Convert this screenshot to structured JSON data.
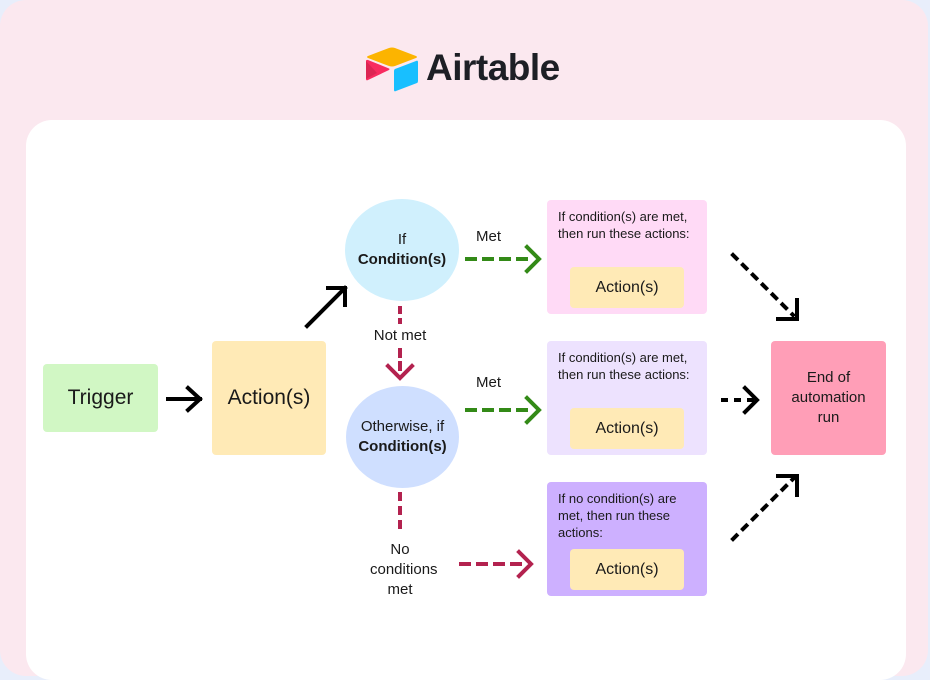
{
  "brand": {
    "name": "Airtable",
    "colors": {
      "yellow": "#fcb400",
      "red": "#f82b60",
      "dark_red": "#ba1e45",
      "blue": "#18bfff"
    }
  },
  "diagram": {
    "trigger": {
      "label": "Trigger",
      "color": "#d1f7c4"
    },
    "initial_action": {
      "label": "Action(s)",
      "color": "#ffeab6"
    },
    "condition_if": {
      "prefix": "If",
      "label": "Condition(s)",
      "color": "#d0f0fd"
    },
    "condition_otherwise": {
      "prefix": "Otherwise, if",
      "label": "Condition(s)",
      "color": "#cfdfff"
    },
    "edge_labels": {
      "met_1": "Met",
      "met_2": "Met",
      "not_met": "Not met",
      "no_conditions_met": [
        "No",
        "conditions",
        "met"
      ]
    },
    "branches": [
      {
        "text": "If condition(s) are met, then run these actions:",
        "action": "Action(s)",
        "color": "#ffdaf6"
      },
      {
        "text": "If condition(s) are met, then run these actions:",
        "action": "Action(s)",
        "color": "#ede2fe"
      },
      {
        "text": "If no condition(s) are met, then run these actions:",
        "action": "Action(s)",
        "color": "#cdb0ff"
      }
    ],
    "end": {
      "lines": [
        "End of",
        "automation",
        "run"
      ],
      "color": "#ff9eb7"
    },
    "arrow_colors": {
      "solid": "#000000",
      "met": "#338a17",
      "not_met": "#b3224f",
      "to_end": "#000000"
    }
  }
}
